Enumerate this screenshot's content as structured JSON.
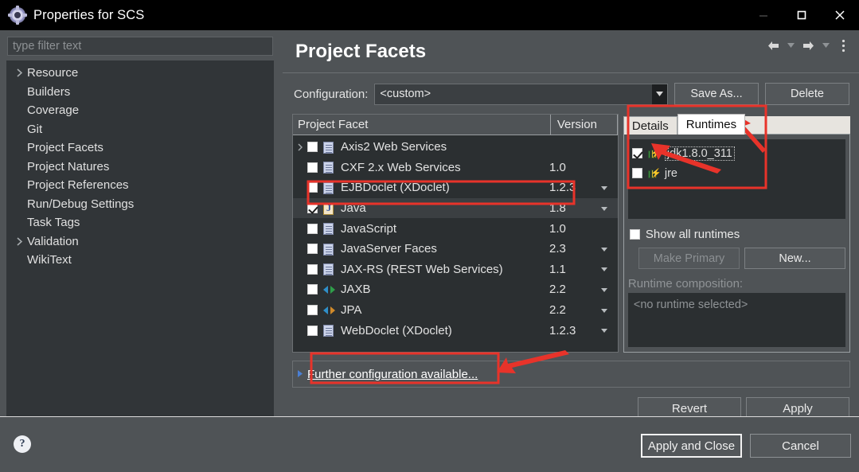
{
  "window": {
    "title": "Properties for SCS",
    "icon": "eclipse-gear-icon",
    "controls": {
      "minimize": "minimize-icon",
      "maximize": "maximize-icon",
      "close": "close-icon"
    }
  },
  "sidebar": {
    "filter_placeholder": "type filter text",
    "filter_value": "",
    "items": [
      {
        "label": "Resource",
        "expandable": true,
        "selected": false
      },
      {
        "label": "Builders",
        "expandable": false,
        "selected": false
      },
      {
        "label": "Coverage",
        "expandable": false,
        "selected": false
      },
      {
        "label": "Git",
        "expandable": false,
        "selected": false
      },
      {
        "label": "Project Facets",
        "expandable": false,
        "selected": false
      },
      {
        "label": "Project Natures",
        "expandable": false,
        "selected": false
      },
      {
        "label": "Project References",
        "expandable": false,
        "selected": false
      },
      {
        "label": "Run/Debug Settings",
        "expandable": false,
        "selected": false
      },
      {
        "label": "Task Tags",
        "expandable": false,
        "selected": false
      },
      {
        "label": "Validation",
        "expandable": true,
        "selected": false
      },
      {
        "label": "WikiText",
        "expandable": false,
        "selected": false
      }
    ]
  },
  "main": {
    "title": "Project Facets",
    "nav": {
      "back": "back-arrow-icon",
      "forward": "forward-arrow-icon",
      "menu": "view-menu-icon"
    },
    "configuration": {
      "label": "Configuration:",
      "value": "<custom>",
      "save_as_label": "Save As...",
      "delete_label": "Delete"
    },
    "facet_table": {
      "columns": [
        "Project Facet",
        "Version"
      ],
      "rows": [
        {
          "name": "Axis2 Web Services",
          "version": "",
          "checked": false,
          "expandable": true,
          "icon": "doc-icon",
          "caret": false,
          "selected": false
        },
        {
          "name": "CXF 2.x Web Services",
          "version": "1.0",
          "checked": false,
          "expandable": false,
          "icon": "doc-icon",
          "caret": false,
          "selected": false
        },
        {
          "name": "EJBDoclet (XDoclet)",
          "version": "1.2.3",
          "checked": false,
          "expandable": false,
          "icon": "doc-icon",
          "caret": true,
          "selected": false
        },
        {
          "name": "Java",
          "version": "1.8",
          "checked": true,
          "expandable": false,
          "icon": "java-icon",
          "caret": true,
          "selected": true
        },
        {
          "name": "JavaScript",
          "version": "1.0",
          "checked": false,
          "expandable": false,
          "icon": "doc-icon",
          "caret": false,
          "selected": false
        },
        {
          "name": "JavaServer Faces",
          "version": "2.3",
          "checked": false,
          "expandable": false,
          "icon": "doc-icon",
          "caret": true,
          "selected": false
        },
        {
          "name": "JAX-RS (REST Web Services)",
          "version": "1.1",
          "checked": false,
          "expandable": false,
          "icon": "doc-icon",
          "caret": true,
          "selected": false
        },
        {
          "name": "JAXB",
          "version": "2.2",
          "checked": false,
          "expandable": false,
          "icon": "arrows-green-icon",
          "caret": true,
          "selected": false
        },
        {
          "name": "JPA",
          "version": "2.2",
          "checked": false,
          "expandable": false,
          "icon": "arrows-orange-icon",
          "caret": true,
          "selected": false
        },
        {
          "name": "WebDoclet (XDoclet)",
          "version": "1.2.3",
          "checked": false,
          "expandable": false,
          "icon": "doc-icon",
          "caret": true,
          "selected": false
        }
      ]
    },
    "right_panel": {
      "tabs": [
        {
          "label": "Details",
          "active": false
        },
        {
          "label": "Runtimes",
          "active": true
        }
      ],
      "runtimes": [
        {
          "label": "jdk1.8.0_311",
          "checked": true,
          "focused": true,
          "icon": "runtime-books-icon"
        },
        {
          "label": "jre",
          "checked": false,
          "focused": false,
          "icon": "runtime-books-icon"
        }
      ],
      "show_all_runtimes": {
        "label": "Show all runtimes",
        "checked": false
      },
      "make_primary_label": "Make Primary",
      "make_primary_disabled": true,
      "new_label": "New...",
      "composition_label": "Runtime composition:",
      "composition_value": "<no runtime selected>"
    },
    "further_config": {
      "link": "Further configuration available...",
      "arrow": "expand-arrow-icon"
    },
    "revert_label": "Revert",
    "apply_label": "Apply"
  },
  "footer": {
    "help_icon": "help-question-icon",
    "apply_and_close_label": "Apply and Close",
    "cancel_label": "Cancel"
  },
  "annotations": {
    "color": "#e8332a",
    "highlights": [
      {
        "target": "java-facet-row"
      },
      {
        "target": "runtimes-tab-and-list"
      },
      {
        "target": "further-configuration-link"
      }
    ],
    "arrows": [
      {
        "target": "runtimes-tab"
      },
      {
        "target": "jdk-runtime-checkbox"
      },
      {
        "target": "further-configuration-link"
      }
    ]
  }
}
